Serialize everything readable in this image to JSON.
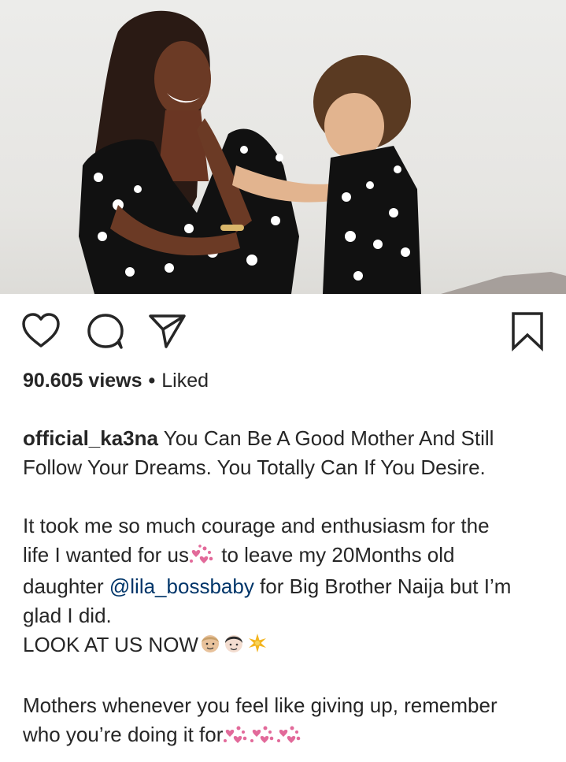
{
  "post": {
    "username": "official_ka3na",
    "caption_line1": " You Can Be A Good Mother And Still",
    "caption_line2": "Follow Your Dreams. You Totally Can If You Desire.",
    "para2_line1": "It took me so much courage and enthusiasm for the",
    "para2_line2a": "life I wanted for us",
    "para2_line2b": " to leave my 20Months old",
    "para2_line3a": "daughter ",
    "mention": "@lila_bossbaby",
    "para2_line3b": " for Big Brother Naija but I’m",
    "para2_line4": "glad I did.",
    "para2_line5": "LOOK AT US NOW",
    "para3_line1": "Mothers whenever you feel like giving up, remember",
    "para3_line2": "who you’re doing it for"
  },
  "stats": {
    "views": "90.605 views",
    "separator": "•",
    "liked": "Liked"
  },
  "icons": {
    "like": "heart-outline-icon",
    "comment": "comment-bubble-icon",
    "share": "paper-plane-icon",
    "save": "bookmark-outline-icon"
  },
  "colors": {
    "text": "#262626",
    "mention": "#003569",
    "emoji_pink": "#e26a9a"
  }
}
